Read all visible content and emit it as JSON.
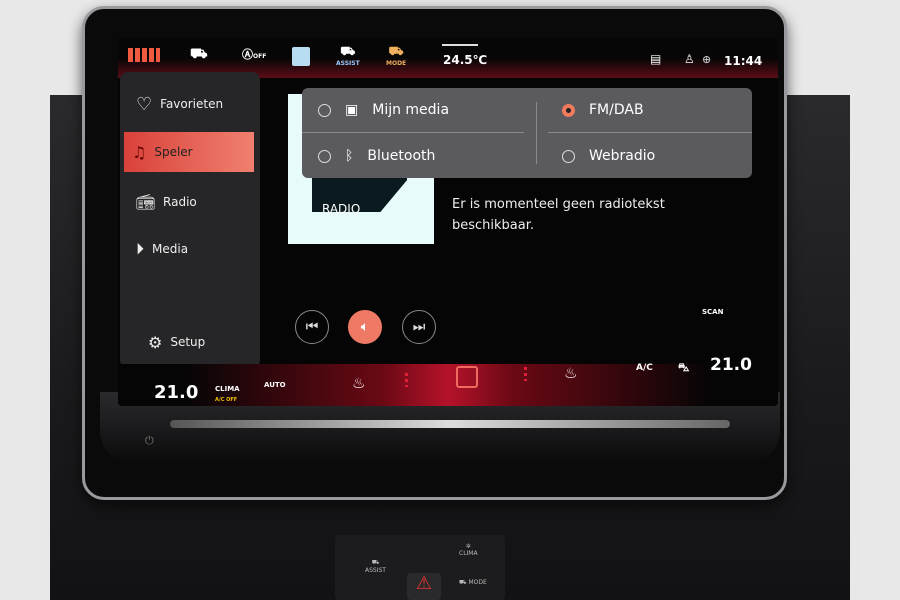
{
  "status_bar": {
    "temperature": "24.5℃",
    "time": "11:44",
    "auto_hold_label": "OFF",
    "assist_label": "ASSIST",
    "mode_label": "MODE",
    "icons": [
      "apps-grid-icon",
      "car-icon",
      "auto-start-stop-icon",
      "parking-icon",
      "assist-icon",
      "drive-mode-icon",
      "message-icon",
      "user-icon",
      "globe-icon"
    ],
    "accent_color": "#e8402e"
  },
  "sidebar": {
    "items": [
      {
        "label": "Favorieten",
        "icon": "heart-icon"
      },
      {
        "label": "Speler",
        "icon": "music-note-icon",
        "active": true
      },
      {
        "label": "Radio",
        "icon": "radio-icon"
      },
      {
        "label": "Media",
        "icon": "play-circle-icon"
      },
      {
        "label": "Setup",
        "icon": "gear-icon"
      }
    ]
  },
  "source_popup": {
    "options": [
      {
        "label": "Mijn media",
        "icon": "media-library-icon",
        "selected": false
      },
      {
        "label": "FM/DAB",
        "selected": true
      },
      {
        "label": "Bluetooth",
        "icon": "bluetooth-icon",
        "selected": false
      },
      {
        "label": "Webradio",
        "selected": false
      }
    ]
  },
  "player": {
    "logo_text": "RADIO",
    "radio_text": "Er is momenteel geen radiotekst beschikbaar.",
    "scan_label": "SCAN"
  },
  "climate": {
    "left_temp": "21.0",
    "clima_label": "CLIMA",
    "ac_off_label": "A/C OFF",
    "auto_label": "AUTO",
    "ac_label": "A/C",
    "right_temp": "21.0"
  },
  "hardware": {
    "assist_label": "ASSIST",
    "clima_label": "CLIMA",
    "mode_label": "MODE"
  }
}
